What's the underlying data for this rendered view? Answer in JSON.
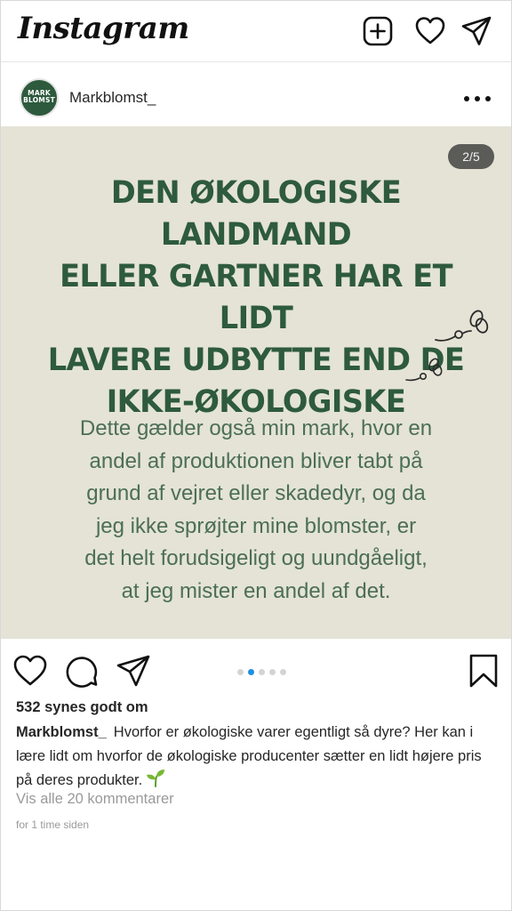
{
  "app": {
    "logo": "Instagram",
    "icons": [
      "add-post-icon",
      "heart-icon",
      "direct-message-icon"
    ]
  },
  "post": {
    "author": {
      "username": "Markblomst_",
      "avatar_text": "MARK BLOMST"
    },
    "image": {
      "page_counter": "2/5",
      "headline_lines": [
        "DEN ØKOLOGISKE LANDMAND",
        "ELLER GARTNER HAR ET LIDT",
        "LAVERE UDBYTTE END DE",
        "IKKE-ØKOLOGISKE"
      ],
      "body_lines": [
        "Dette gælder også min mark, hvor en",
        "andel af produktionen bliver tabt på",
        "grund af vejret eller skadedyr, og da",
        "jeg ikke sprøjter mine blomster, er",
        "det helt forudsigeligt og uundgåeligt,",
        "at jeg mister en andel af det."
      ],
      "background_color": "#e4e3d6",
      "headline_color": "#2e5a3e",
      "body_color": "#4c6e57"
    },
    "carousel": {
      "total": 5,
      "active_index": 1,
      "active_color": "#1e8fe1"
    },
    "likes": "532 synes godt om",
    "caption": {
      "username": "Markblomst_",
      "text": "Hvorfor er økologiske varer egentligt så dyre? Her kan i lære lidt om hvorfor de økologiske producenter sætter en lidt højere pris på deres produkter.",
      "emoji": "seedling-icon"
    },
    "view_comments": "Vis alle 20 kommentarer",
    "time_ago": "for 1 time siden"
  }
}
